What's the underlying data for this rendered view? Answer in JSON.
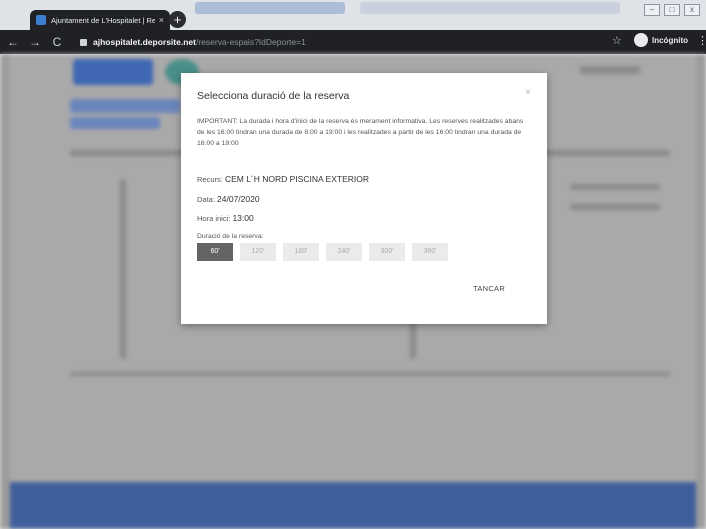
{
  "browser": {
    "tab_title": "Ajuntament de L'Hospitalet | Re",
    "tab_close": "×",
    "newtab": "+",
    "url_host": "ajhospitalet.deporsite.net",
    "url_path": "/reserva-espais?IdDeporte=1",
    "incognito_label": "Incógnito"
  },
  "modal": {
    "title": "Selecciona duració de la reserva",
    "close": "×",
    "notice": "IMPORTANT: La durada i hora d'inici de la reserva és merament informativa. Les reserves realitzades abans de les 16:00 tindran una durada de 8:00 a 19:00 i les realitzades a partir de les 16:00 tindran una durada de 16:00 a 19:00",
    "recurs_label": "Recurs:",
    "recurs_value": "CEM L´H NORD PISCINA EXTERIOR",
    "data_label": "Data:",
    "data_value": "24/07/2020",
    "hora_label": "Hora inici:",
    "hora_value": "13:00",
    "durada_label": "Duració de la reserva:",
    "durations": [
      "60'",
      "120'",
      "180'",
      "240'",
      "300'",
      "360'"
    ],
    "selected_duration": "60'",
    "close_button": "TANCAR"
  },
  "colors": {
    "selected_button": "#646464",
    "unselected_button": "#ebebeb",
    "overlay": "#9c9c9c"
  }
}
